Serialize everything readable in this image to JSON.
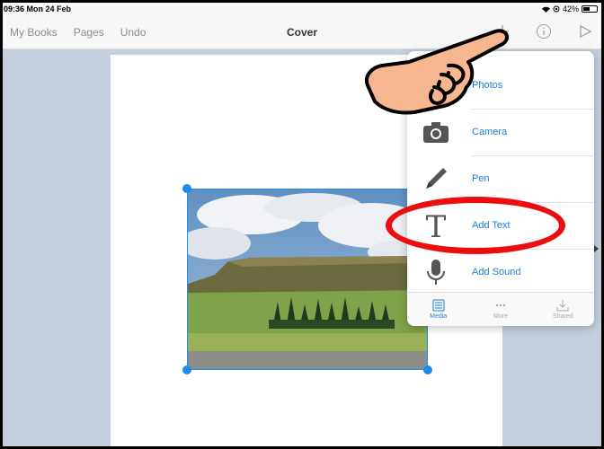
{
  "status_bar": {
    "time": "09:36  Mon 24 Feb",
    "battery": "42%"
  },
  "toolbar": {
    "left_items": [
      "My Books",
      "Pages",
      "Undo"
    ],
    "title": "Cover",
    "right_icons": [
      "plus-icon",
      "info-icon",
      "play-icon"
    ]
  },
  "popover": {
    "items": [
      {
        "label": "Photos",
        "icon": "photos-icon"
      },
      {
        "label": "Camera",
        "icon": "camera-icon"
      },
      {
        "label": "Pen",
        "icon": "pen-icon"
      },
      {
        "label": "Add Text",
        "icon": "text-icon"
      },
      {
        "label": "Add Sound",
        "icon": "microphone-icon"
      }
    ],
    "tabs": [
      {
        "label": "Media",
        "icon": "list-icon",
        "active": true
      },
      {
        "label": "More",
        "icon": "ellipsis-icon",
        "active": false
      },
      {
        "label": "Shared",
        "icon": "download-icon",
        "active": false
      }
    ]
  },
  "colors": {
    "accent": "#1d8cf0",
    "highlight": "#ec0e0e",
    "page_bg": "#c4d0de"
  }
}
